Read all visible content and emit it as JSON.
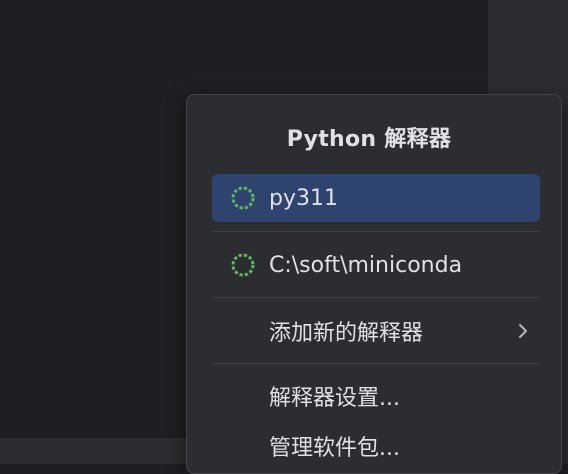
{
  "popup": {
    "title": "Python 解释器",
    "items": [
      {
        "label": "py311",
        "icon": "loading-spinner-icon",
        "selected": true
      },
      {
        "label": "C:\\soft\\miniconda",
        "icon": "loading-spinner-icon",
        "selected": false
      },
      {
        "label": "添加新的解释器",
        "has_submenu": true
      },
      {
        "label": "解释器设置..."
      },
      {
        "label": "管理软件包..."
      }
    ]
  },
  "colors": {
    "editor_bg": "#1e1f22",
    "popup_bg": "#2b2d30",
    "selection": "#2e436e",
    "text": "#dfe1e5",
    "spinner": "#5fb85f"
  }
}
